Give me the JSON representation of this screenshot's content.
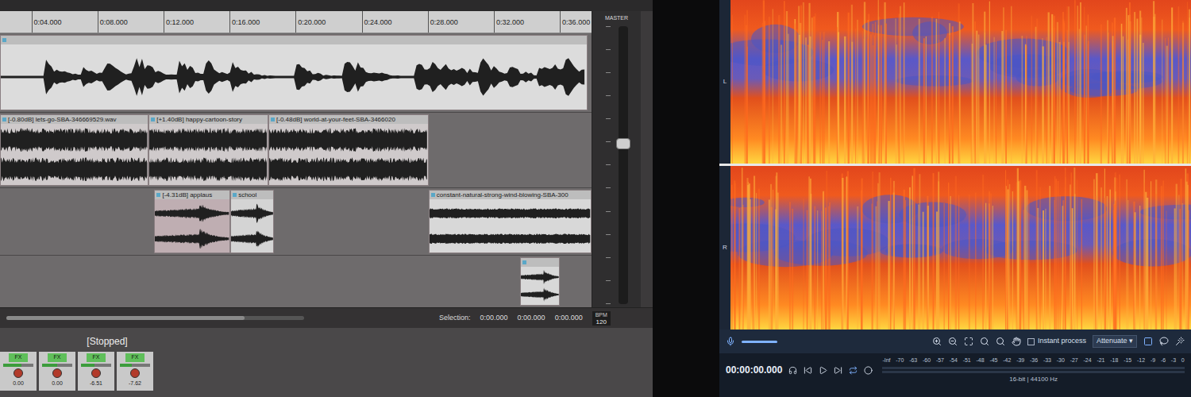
{
  "daw": {
    "ruler": [
      {
        "label": "0:04.000",
        "t": 4
      },
      {
        "label": "0:08.000",
        "t": 8
      },
      {
        "label": "0:12.000",
        "t": 12
      },
      {
        "label": "0:16.000",
        "t": 16
      },
      {
        "label": "0:20.000",
        "t": 20
      },
      {
        "label": "0:24.000",
        "t": 24
      },
      {
        "label": "0:28.000",
        "t": 28
      },
      {
        "label": "0:32.000",
        "t": 32
      },
      {
        "label": "0:36.000",
        "t": 36
      }
    ],
    "tracks": [
      {
        "items": [
          {
            "name": "",
            "start": 1.5,
            "end": 37.7,
            "color": "#dcdcdc",
            "kind": "speech",
            "stereo": false
          }
        ]
      },
      {
        "items": [
          {
            "name": "[-0.80dB] lets-go-SBA-346669529.wav",
            "start": 0,
            "end": 11.1,
            "color": "#cfcacb",
            "kind": "music",
            "stereo": true
          },
          {
            "name": "[+1.40dB] happy-cartoon-story",
            "start": 11.1,
            "end": 18.35,
            "color": "#cfcacb",
            "kind": "music",
            "stereo": true
          },
          {
            "name": "[-0.48dB] world-at-your-feet-SBA-3466020",
            "start": 18.35,
            "end": 28.05,
            "color": "#cfcacb",
            "kind": "music",
            "stereo": true
          }
        ]
      },
      {
        "items": [
          {
            "name": "[-4.31dB] applaus",
            "start": 11.45,
            "end": 16.05,
            "color": "#bfaeb2",
            "kind": "hit",
            "stereo": true
          },
          {
            "name": "school",
            "start": 16.05,
            "end": 18.7,
            "color": "#d4d4d4",
            "kind": "hit",
            "stereo": true
          },
          {
            "name": "constant-natural-strong-wind-blowing-SBA-300",
            "start": 28.05,
            "end": 38.2,
            "color": "#d8d8d8",
            "kind": "noise",
            "stereo": true
          }
        ]
      },
      {
        "items": [
          {
            "name": "",
            "start": 33.6,
            "end": 36.0,
            "color": "#d8d8d8",
            "kind": "hit",
            "stereo": true
          }
        ]
      }
    ],
    "master": {
      "label": "MASTER",
      "level": 0.55
    },
    "transport": {
      "status": "[Stopped]",
      "selection_label": "Selection:",
      "selection": [
        "0:00.000",
        "0:00.000",
        "0:00.000"
      ],
      "bpm_label": "BPM",
      "bpm": "120"
    },
    "mixer": {
      "strips": [
        {
          "fx": "FX",
          "reading": "0.00",
          "level": 0.6
        },
        {
          "fx": "FX",
          "reading": "0.00",
          "level": 0.5
        },
        {
          "fx": "FX",
          "reading": "-6.51",
          "level": 0.45
        },
        {
          "fx": "FX",
          "reading": "-7.62",
          "level": 0.4
        }
      ]
    }
  },
  "rx": {
    "channels": [
      "L",
      "R"
    ],
    "toolbar": {
      "instant_process": {
        "label": "Instant process",
        "checked": false
      },
      "mode": "Attenuate"
    },
    "time": "00:00:00.000",
    "meter_scale": [
      "-Inf",
      "-70",
      "-63",
      "-60",
      "-57",
      "-54",
      "-51",
      "-48",
      "-45",
      "-42",
      "-39",
      "-36",
      "-33",
      "-30",
      "-27",
      "-24",
      "-21",
      "-18",
      "-15",
      "-12",
      "-9",
      "-6",
      "-3",
      "0"
    ],
    "format": "16-bit | 44100 Hz"
  }
}
